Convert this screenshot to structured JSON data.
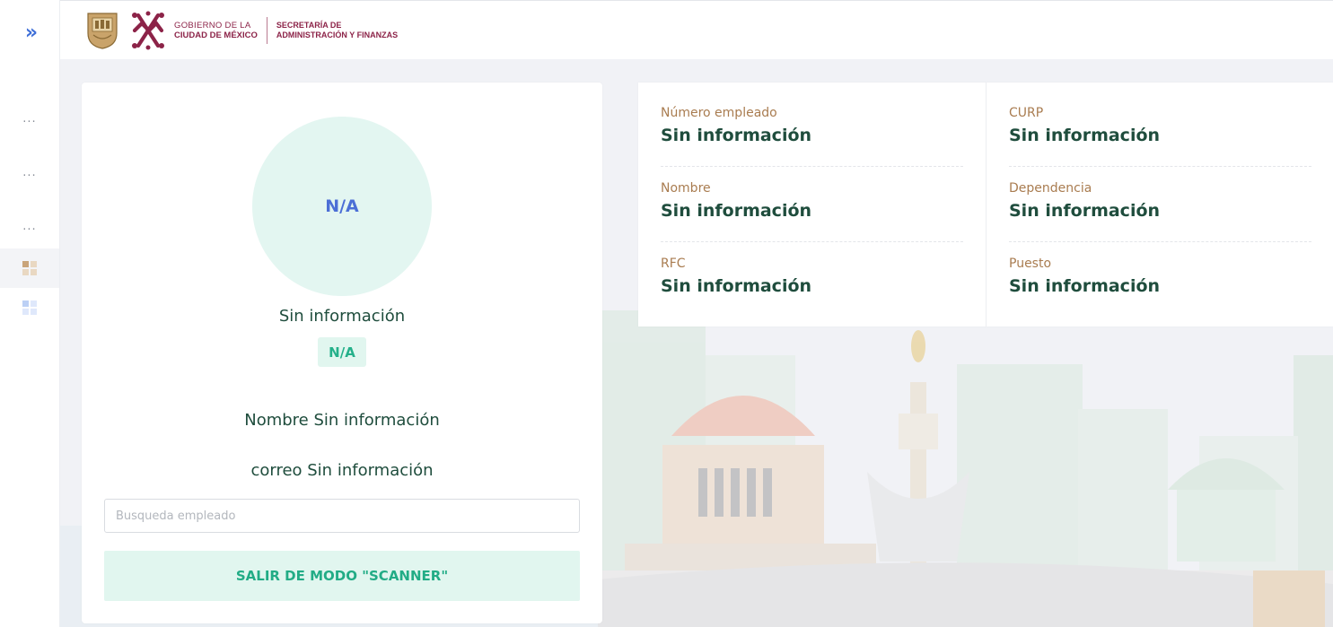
{
  "header": {
    "gov_line1": "GOBIERNO DE LA",
    "gov_line2": "CIUDAD DE MÉXICO",
    "sec_line1": "SECRETARÍA DE",
    "sec_line2": "ADMINISTRACIÓN Y FINANZAS"
  },
  "sidebar": {
    "toggle_icon": "double-chevron-right-icon",
    "items": [
      {
        "label": "···"
      },
      {
        "label": "···"
      },
      {
        "label": "···"
      }
    ],
    "active_grid_colors": [
      "#c9a47a",
      "#e9d8c2",
      "#e9d8c2",
      "#e9d8c2"
    ],
    "second_grid_colors": [
      "#bcd0f5",
      "#dfe8fb",
      "#dfe8fb",
      "#dfe8fb"
    ]
  },
  "profile": {
    "avatar_text": "N/A",
    "name": "Sin información",
    "badge": "N/A",
    "nombre_line": "Nombre Sin información",
    "correo_line": "correo Sin información",
    "search_placeholder": "Busqueda empleado",
    "search_value": "",
    "scanner_button": "SALIR DE MODO \"SCANNER\""
  },
  "info": {
    "left": [
      {
        "label": "Número empleado",
        "value": "Sin información"
      },
      {
        "label": "Nombre",
        "value": "Sin información"
      },
      {
        "label": "RFC",
        "value": "Sin información"
      }
    ],
    "right": [
      {
        "label": "CURP",
        "value": "Sin información"
      },
      {
        "label": "Dependencia",
        "value": "Sin información"
      },
      {
        "label": "Puesto",
        "value": "Sin información"
      }
    ]
  },
  "colors": {
    "brand": "#8c2348",
    "accent_green": "#22ac86",
    "text_dark_green": "#1f4d3d",
    "label_gold": "#a97c50",
    "avatar_blue": "#4c6fd6"
  }
}
